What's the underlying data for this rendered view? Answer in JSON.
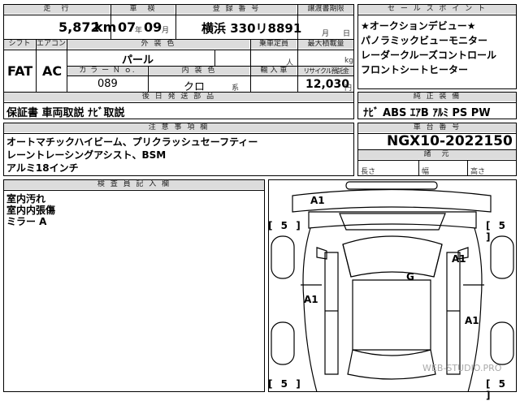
{
  "headers": {
    "mileage": "走　行",
    "inspection": "車　検",
    "registration": "登 録 番 号",
    "transfer_deadline": "譲渡書期限",
    "shift": "シフト",
    "aircon": "エアコン",
    "exterior_color": "外 装 色",
    "capacity": "乗車定員",
    "max_load": "最大積載量",
    "color_no": "カ ラ ー Ｎ ｏ.",
    "interior_color": "内 装 色",
    "import": "輸 入 車",
    "recycle_fee": "リサイクル預託金",
    "shipping_parts": "後 日 発 送 部 品",
    "sales_points": "セ ー ル ス ポ イ ン ト",
    "equipment": "純 正 装 備",
    "notes": "注 意 事 項 欄",
    "chassis": "車 台 番 号",
    "dimensions": "諸　元",
    "inspector": "検 査 員 記 入 欄"
  },
  "values": {
    "mileage": "5,872",
    "mileage_unit": "km",
    "inspection_year": "07",
    "inspection_year_unit": "年",
    "inspection_month": "09",
    "inspection_month_unit": "月",
    "registration": "横浜 330リ8891",
    "transfer_month_unit": "月",
    "transfer_day_unit": "日",
    "shift": "FAT",
    "aircon": "AC",
    "exterior_color": "パール",
    "capacity_unit": "人",
    "max_load_unit": "kg",
    "color_no": "089",
    "interior_color": "クロ",
    "interior_suffix": "系",
    "recycle_fee": "12,030",
    "recycle_unit": "円",
    "shipping_parts": "保証書 車両取説 ﾅﾋﾞ取説",
    "equipment": "ﾅﾋﾞ ABS ｴｱB ｱﾙﾐ PS PW",
    "chassis": "NGX10-2022150",
    "length_label": "長さ",
    "width_label": "幅",
    "height_label": "高さ"
  },
  "sales_points": [
    "★オークションデビュー★",
    "パノラミックビューモニター",
    "レーダークルーズコントロール",
    "フロントシートヒーター"
  ],
  "notes": [
    "オートマチックハイビーム、プリクラッシュセーフティー",
    "レーントレーシングアシスト、BSM",
    "アルミ18インチ"
  ],
  "inspector_notes": [
    "室内汚れ",
    "室内内張傷",
    "ミラー A"
  ],
  "diagram": {
    "a1_front": "A1",
    "a1_right_mid": "A1",
    "a1_left": "A1",
    "a1_right_low": "A1",
    "g_roof": "G",
    "tire_fl": "[ 5 ]",
    "tire_fr": "[ 5 ]",
    "tire_rl": "[ 5 ]",
    "tire_rr": "[ 5 ]",
    "watermark": "WEB-STUDIO.PRO"
  }
}
